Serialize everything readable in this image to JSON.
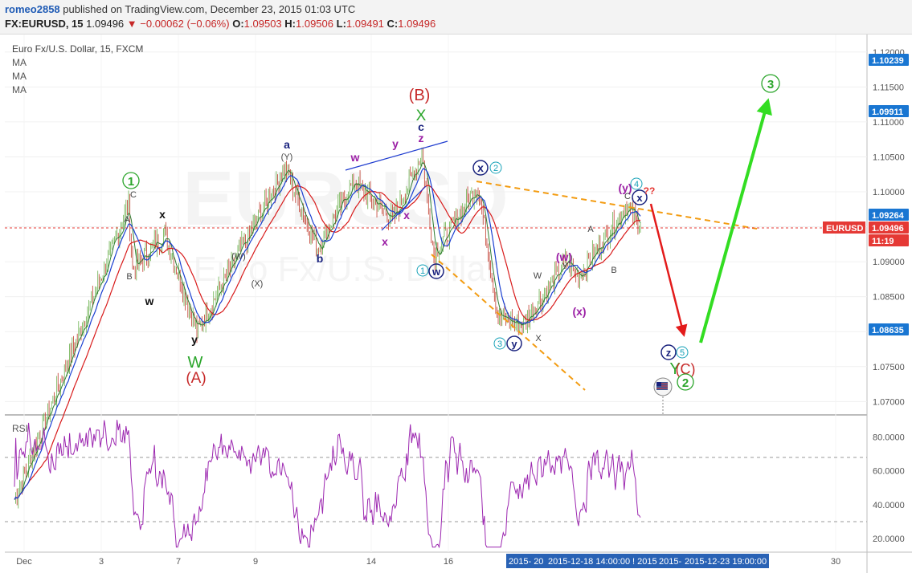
{
  "header": {
    "user": "romeo2858",
    "published": "published on TradingView.com, December 23, 2015 01:03 UTC",
    "symbol": "FX:EURUSD, 15",
    "last": "1.09496",
    "change": "▼ −0.00062 (−0.06%)",
    "o_label": "O:",
    "o": "1.09503",
    "h_label": "H:",
    "h": "1.09506",
    "l_label": "L:",
    "l": "1.09491",
    "c_label": "C:",
    "c": "1.09496"
  },
  "legend": {
    "title": "Euro Fx/U.S. Dollar, 15, FXCM",
    "ma": [
      "MA",
      "MA",
      "MA"
    ],
    "rsi": "RSI"
  },
  "watermark": {
    "symbol": "EURUSD",
    "desc": "Euro Fx/U.S. Dollar"
  },
  "price_axis": {
    "ticks": [
      "1.12000",
      "1.11500",
      "1.11000",
      "1.10500",
      "1.10000",
      "1.09500",
      "1.09000",
      "1.08500",
      "1.08000",
      "1.07500",
      "1.07000"
    ],
    "badges": [
      {
        "text": "1.10239",
        "color": "#1976d2"
      },
      {
        "text": "1.09911",
        "color": "#1976d2"
      },
      {
        "text": "1.09264",
        "color": "#1976d2"
      },
      {
        "text": "1.09496",
        "color": "#e53935"
      },
      {
        "text": "11:19",
        "color": "#e53935"
      },
      {
        "text": "1.08635",
        "color": "#1976d2"
      }
    ],
    "symbol_badge": "EURUSD"
  },
  "rsi_axis": {
    "ticks": [
      "80.0000",
      "60.0000",
      "40.0000",
      "20.0000"
    ]
  },
  "time_axis": {
    "ticks": [
      "Dec",
      "3",
      "7",
      "9",
      "14",
      "16",
      "30"
    ],
    "range_labels": [
      "2015- 20",
      "2015-12-18 14:00:00",
      "! 2015",
      "2015-",
      "2015-12-23 19:00:00"
    ]
  },
  "colors": {
    "up": "#6ab04c",
    "down": "#c0392b",
    "ma_blue": "#1a3fd1",
    "ma_red": "#d81b1b",
    "ma_green": "#2e7d32",
    "rsi": "#9c27b0",
    "green_arrow": "#33dd22",
    "red_arrow": "#e31b1b",
    "orange_trend": "#f39c12",
    "blue_trend": "#1f3ccf"
  },
  "annotations": {
    "circled": [
      "1",
      "3",
      "2",
      "4",
      "5",
      "1",
      "3",
      "x",
      "w",
      "y",
      "x",
      "z"
    ],
    "labels": [
      "C",
      "A",
      "B",
      "x",
      "w",
      "y",
      "W",
      "(A)",
      "a",
      "(Y)",
      "(W)",
      "(X)",
      "b",
      "w",
      "y",
      "z",
      "c",
      "X",
      "(B)",
      "x",
      "x",
      "W",
      "X",
      "Y",
      "(w)",
      "(x)",
      "(y)",
      "A",
      "B",
      "C",
      "Y",
      "(C)",
      "??"
    ]
  },
  "chart_data": {
    "type": "line",
    "instrument": "EURUSD",
    "interval": "15",
    "price_ylim": [
      1.0682,
      1.1225
    ],
    "rsi_ylim": [
      12,
      92
    ],
    "rsi_levels": [
      70,
      30
    ],
    "current_price": 1.09496,
    "pivots": [
      {
        "x": "Dec 1",
        "y": 1.056
      },
      {
        "x": "Dec 3",
        "y": 1.098
      },
      {
        "x": "Dec 3",
        "y": 1.089
      },
      {
        "x": "Dec 4",
        "y": 1.094
      },
      {
        "x": "Dec 7",
        "y": 1.08
      },
      {
        "x": "Dec 9",
        "y": 1.1035
      },
      {
        "x": "Dec 10",
        "y": 1.092
      },
      {
        "x": "Dec 11",
        "y": 1.1015
      },
      {
        "x": "Dec 14",
        "y": 1.096
      },
      {
        "x": "Dec 15",
        "y": 1.1055
      },
      {
        "x": "Dec 15",
        "y": 1.091
      },
      {
        "x": "Dec 16",
        "y": 1.101
      },
      {
        "x": "Dec 17",
        "y": 1.082
      },
      {
        "x": "Dec 18",
        "y": 1.081
      },
      {
        "x": "Dec 21",
        "y": 1.09
      },
      {
        "x": "Dec 22",
        "y": 1.088
      },
      {
        "x": "Dec 22",
        "y": 1.098
      },
      {
        "x": "Dec 23",
        "y": 1.09496
      }
    ],
    "projection": [
      {
        "x": "Dec 23",
        "y": 1.0975
      },
      {
        "x": "Dec 24",
        "y": 1.0865
      },
      {
        "x": "Dec 25",
        "y": 1.113
      }
    ],
    "rsi_range": [
      15,
      90
    ]
  }
}
